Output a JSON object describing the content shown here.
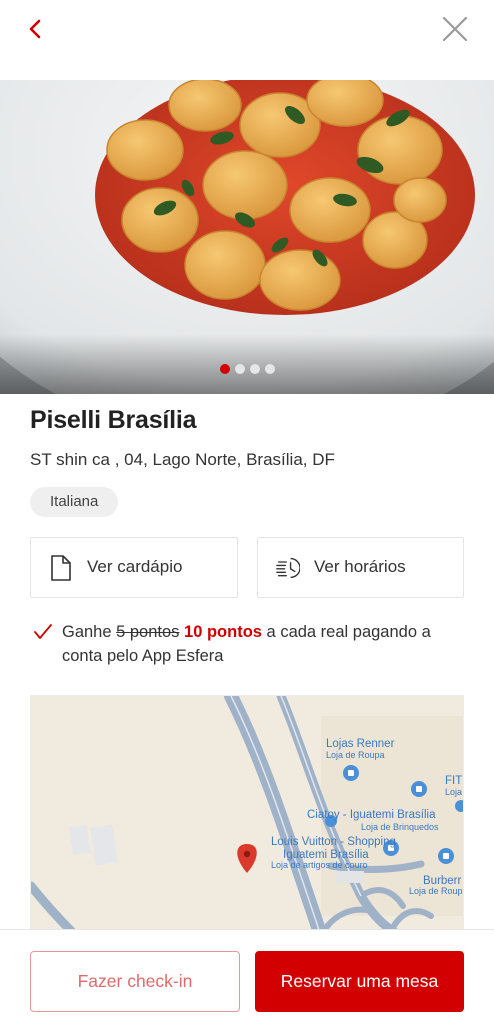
{
  "nav": {
    "back_icon": "chevron-left-icon",
    "close_icon": "close-icon",
    "accent": "#d10000"
  },
  "hero": {
    "image": "tortellini-in-tomato-sauce-photo",
    "slide_count": 4,
    "active_slide": 1
  },
  "restaurant": {
    "name": "Piselli Brasília",
    "address": "ST shin ca , 04, Lago Norte, Brasília, DF",
    "category": "Italiana"
  },
  "actions": {
    "menu_label": "Ver cardápio",
    "menu_icon": "document-icon",
    "hours_label": "Ver horários",
    "hours_icon": "clock-list-icon"
  },
  "points": {
    "prefix": "Ganhe ",
    "old_points": "5 pontos",
    "new_points": "10 pontos",
    "suffix": " a cada real pagando a conta pelo App Esfera"
  },
  "map": {
    "labels": [
      {
        "title": "Lojas Renner",
        "subtitle": "Loja de Roupa"
      },
      {
        "title": "FIT",
        "subtitle": "Loja"
      },
      {
        "title": "Ciatoy - Iguatemi Brasília",
        "subtitle": "Loja de Brinquedos"
      },
      {
        "title": "Louis Vuitton - Shopping Iguatemi Brasília",
        "title_line1": "Louis Vuitton - Shopping",
        "title_line2": "Iguatemi Brasília",
        "subtitle": "Loja de artigos de couro"
      },
      {
        "title": "Burberr",
        "subtitle": "Loja de Roup"
      }
    ],
    "pin_color": "#d93a2b",
    "poi_color": "#4a90d9"
  },
  "buttons": {
    "checkin": "Fazer check-in",
    "reserve": "Reservar uma mesa"
  }
}
